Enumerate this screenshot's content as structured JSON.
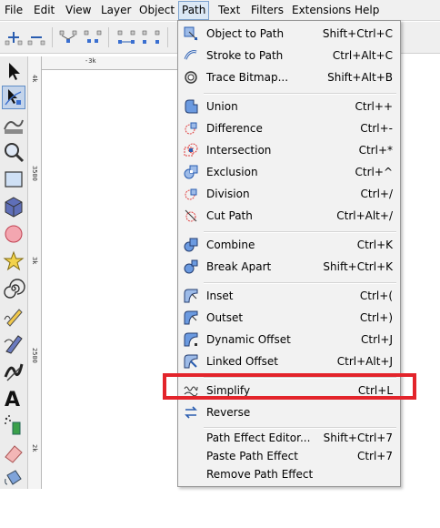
{
  "menubar": {
    "items": [
      "File",
      "Edit",
      "View",
      "Layer",
      "Object",
      "Path",
      "Text",
      "Filters",
      "Extensions",
      "Help"
    ]
  },
  "rulers": {
    "h_label": "-3k",
    "v_labels": [
      "4k",
      "3500",
      "3k",
      "2500",
      "2k"
    ]
  },
  "path_menu": {
    "items": [
      {
        "label": "Object to Path",
        "shortcut": "Shift+Ctrl+C",
        "icon": "object-to-path-icon"
      },
      {
        "label": "Stroke to Path",
        "shortcut": "Ctrl+Alt+C",
        "icon": "stroke-to-path-icon"
      },
      {
        "label": "Trace Bitmap...",
        "shortcut": "Shift+Alt+B",
        "icon": "trace-bitmap-icon"
      },
      {
        "label": "Union",
        "shortcut": "Ctrl++",
        "icon": "union-icon"
      },
      {
        "label": "Difference",
        "shortcut": "Ctrl+-",
        "icon": "difference-icon"
      },
      {
        "label": "Intersection",
        "shortcut": "Ctrl+*",
        "icon": "intersection-icon"
      },
      {
        "label": "Exclusion",
        "shortcut": "Ctrl+^",
        "icon": "exclusion-icon"
      },
      {
        "label": "Division",
        "shortcut": "Ctrl+/",
        "icon": "division-icon"
      },
      {
        "label": "Cut Path",
        "shortcut": "Ctrl+Alt+/",
        "icon": "cut-path-icon"
      },
      {
        "label": "Combine",
        "shortcut": "Ctrl+K",
        "icon": "combine-icon"
      },
      {
        "label": "Break Apart",
        "shortcut": "Shift+Ctrl+K",
        "icon": "break-apart-icon"
      },
      {
        "label": "Inset",
        "shortcut": "Ctrl+(",
        "icon": "inset-icon"
      },
      {
        "label": "Outset",
        "shortcut": "Ctrl+)",
        "icon": "outset-icon"
      },
      {
        "label": "Dynamic Offset",
        "shortcut": "Ctrl+J",
        "icon": "dynamic-offset-icon"
      },
      {
        "label": "Linked Offset",
        "shortcut": "Ctrl+Alt+J",
        "icon": "linked-offset-icon"
      },
      {
        "label": "Simplify",
        "shortcut": "Ctrl+L",
        "icon": "simplify-icon"
      },
      {
        "label": "Reverse",
        "shortcut": "",
        "icon": "reverse-icon"
      },
      {
        "label": "Path Effect Editor...",
        "shortcut": "Shift+Ctrl+7",
        "icon": ""
      },
      {
        "label": "Paste Path Effect",
        "shortcut": "Ctrl+7",
        "icon": ""
      },
      {
        "label": "Remove Path Effect",
        "shortcut": "",
        "icon": ""
      }
    ]
  },
  "colors": {
    "highlight": "#e3242b",
    "menu_active_bg": "#dbe8f5",
    "icon_blue": "#5b8fd6",
    "icon_red": "#e04040"
  }
}
